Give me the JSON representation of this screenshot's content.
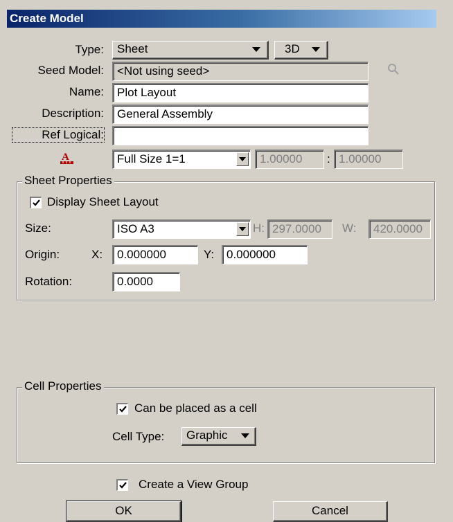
{
  "window": {
    "title": "Create Model"
  },
  "form": {
    "type_label": "Type:",
    "type_value": "Sheet",
    "dim_value": "3D",
    "seed_label": "Seed Model:",
    "seed_value": "<Not using seed>",
    "name_label": "Name:",
    "name_value": "Plot Layout",
    "description_label": "Description:",
    "description_value": "General Assembly",
    "ref_logical_label": "Ref Logical:",
    "ref_logical_value": "",
    "scale_value": "Full Size 1=1",
    "scale_num": "1.00000",
    "scale_sep": ":",
    "scale_den": "1.00000"
  },
  "sheet_properties": {
    "title": "Sheet Properties",
    "display_layout_label": "Display Sheet Layout",
    "display_layout_checked": true,
    "size_label": "Size:",
    "size_value": "ISO A3",
    "h_label": "H:",
    "h_value": "297.0000",
    "w_label": "W:",
    "w_value": "420.0000",
    "origin_label": "Origin:",
    "x_label": "X:",
    "x_value": "0.000000",
    "y_label": "Y:",
    "y_value": "0.000000",
    "rotation_label": "Rotation:",
    "rotation_value": "0.0000"
  },
  "cell_properties": {
    "title": "Cell Properties",
    "placeable_label": "Can be placed as a cell",
    "placeable_checked": true,
    "cell_type_label": "Cell Type:",
    "cell_type_value": "Graphic"
  },
  "footer": {
    "view_group_label": "Create a View Group",
    "view_group_checked": true,
    "ok_label": "OK",
    "cancel_label": "Cancel"
  },
  "icons": {
    "seed_browse": "magnifier-icon",
    "annotation_scale": "annotation-scale-icon"
  },
  "colors": {
    "title_bar_start": "#0a246a",
    "title_bar_end": "#a6caf0",
    "dialog_bg": "#d4d0c8"
  }
}
